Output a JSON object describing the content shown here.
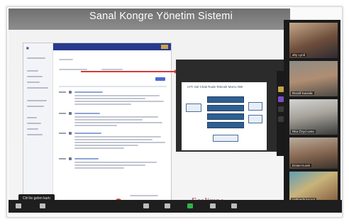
{
  "banner": {
    "title": "Sanal Kongre Yönetim Sistemi"
  },
  "tooltip": {
    "text": "Ctrl ile gelen kartı"
  },
  "slide": {
    "title": "CITI Sel Chak Rude Telecek Morru NW"
  },
  "logo": {
    "text": "Ecolimpe"
  },
  "participants": [
    {
      "name": "ahy Lyrid"
    },
    {
      "name": "Recell Kaviola"
    },
    {
      "name": "Rita Özyd cana"
    },
    {
      "name": "Ernan Kuralı"
    },
    {
      "name": "cettinede kurunt"
    }
  ],
  "icons": {
    "app_logo": "app-logo",
    "user_badge": "user-badge-icon"
  },
  "colors": {
    "app_header": "#273a8c",
    "arrow": "#d33a3a",
    "logo": "#9b2121"
  }
}
